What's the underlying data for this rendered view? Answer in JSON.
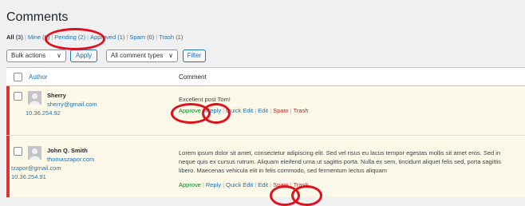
{
  "page": {
    "title": "Comments"
  },
  "filters": {
    "all_label": "All",
    "all_count": "(3)",
    "mine_label": "Mine",
    "mine_count": "(0)",
    "pending_label": "Pending",
    "pending_count": "(2)",
    "approved_label": "Approved",
    "approved_count": "(1)",
    "spam_label": "Spam",
    "spam_count": "(0)",
    "trash_label": "Trash",
    "trash_count": "(1)",
    "separator": "|"
  },
  "toolbar": {
    "bulk_actions": "Bulk actions",
    "apply": "Apply",
    "comment_types": "All comment types",
    "filter": "Filter",
    "chevron": "∨"
  },
  "table": {
    "col_author": "Author",
    "col_comment": "Comment"
  },
  "comments": [
    {
      "author": "Sherry",
      "email": "sherry@gmail.com",
      "ip": "10.36.254.92",
      "text": "Excellent post Tom!",
      "actions": {
        "approve": "Approve",
        "reply": "Reply",
        "quick_edit": "Quick Edit",
        "edit": "Edit",
        "spam": "Spam",
        "trash": "Trash"
      }
    },
    {
      "author": "John Q. Smith",
      "url": "thomaszapor.com",
      "email": "tzapor@gmail.com",
      "ip": "10.36.254.91",
      "text_lines": [
        "Lorem ipsum dolor sit amet, consectetur adipiscing elit. Sed vel risus eu lacus tempor egestas mollis sit amet eros. Sed in",
        "neque quis ex cursus rutrum. Aliquam eleifend urna ut sagittis porta. Nulla ex sem, tincidunt aliquet felis sed, porta sagittis",
        "libero. Maecenas vehicula elit in felis commodo, sed fermentum lectus aliquam"
      ],
      "actions": {
        "approve": "Approve",
        "reply": "Reply",
        "quick_edit": "Quick Edit",
        "edit": "Edit",
        "spam": "Spam",
        "trash": "Trash"
      }
    }
  ],
  "colors": {
    "link": "#2271b1",
    "approve": "#008a20",
    "danger": "#b32d2e",
    "pending_row": "#fcf9e8",
    "annotation_ring": "#e0101d"
  }
}
